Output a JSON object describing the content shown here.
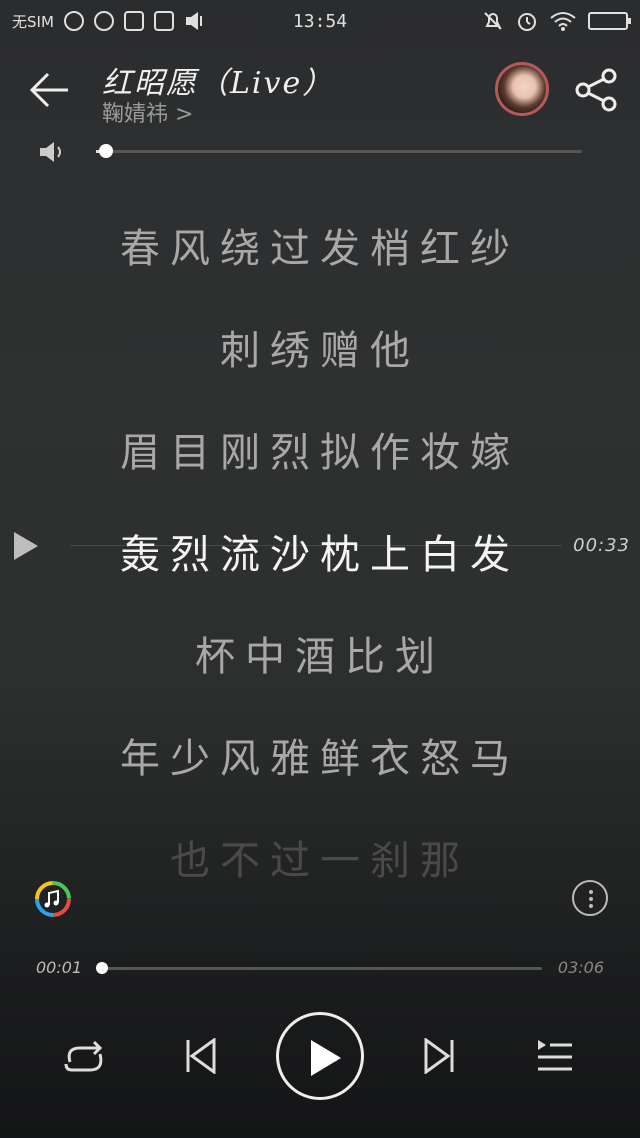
{
  "status_bar": {
    "carrier": "无SIM",
    "time": "13:54"
  },
  "header": {
    "song_title": "红昭愿（Live）",
    "artist": "鞠婧祎",
    "artist_chevron": ">"
  },
  "volume": {
    "level": 0.02
  },
  "lyrics": [
    "春风绕过发梢红纱",
    "刺绣赠他",
    "眉目刚烈拟作妆嫁",
    "轰烈流沙枕上白发",
    "杯中酒比划",
    "年少风雅鲜衣怒马",
    "也不过一刹那"
  ],
  "current_lyric_index": 3,
  "seek_preview_time": "00:33",
  "playback": {
    "current_time": "00:01",
    "duration": "03:06",
    "progress": 0.005
  },
  "colors": {
    "accent": "#ffffff",
    "lyric_dim": "#a8a8a8",
    "lyric_active": "#f4f4f4"
  }
}
